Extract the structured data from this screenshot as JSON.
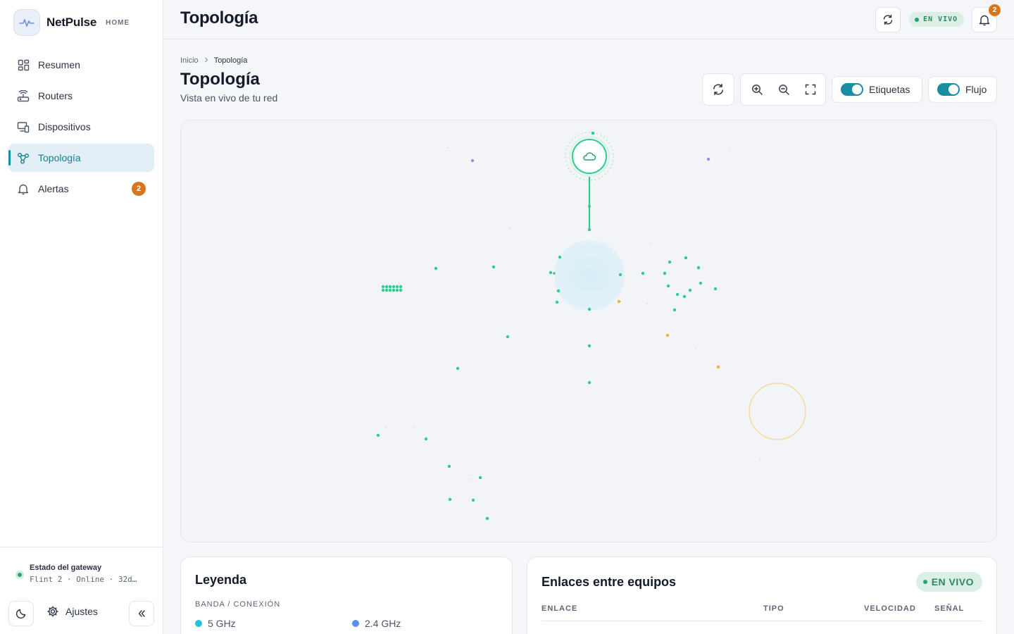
{
  "brand": {
    "name": "NetPulse",
    "tag": "HOME"
  },
  "nav": [
    {
      "label": "Resumen",
      "icon": "grid-icon"
    },
    {
      "label": "Routers",
      "icon": "router-icon"
    },
    {
      "label": "Dispositivos",
      "icon": "devices-icon"
    },
    {
      "label": "Topología",
      "icon": "topology-icon",
      "active": true
    },
    {
      "label": "Alertas",
      "icon": "bell-icon",
      "badge": "2"
    }
  ],
  "gateway": {
    "title": "Estado del gateway",
    "status": "Flint 2 · Online · 32d…"
  },
  "footer": {
    "settings_label": "Ajustes"
  },
  "topbar": {
    "title": "Topología",
    "live_label": "EN VIVO",
    "notifications": "2"
  },
  "breadcrumb": {
    "home": "Inicio",
    "current": "Topología"
  },
  "page": {
    "title": "Topología",
    "subtitle": "Vista en vivo de tu red"
  },
  "toolbar": {
    "labels_toggle": "Etiquetas",
    "labels_on": true,
    "flow_toggle": "Flujo",
    "flow_on": true
  },
  "legend": {
    "title": "Leyenda",
    "section": "BANDA / CONEXIÓN",
    "items": [
      {
        "label": "5 GHz",
        "color": "#22c3d8"
      },
      {
        "label": "2.4 GHz",
        "color": "#5b8fe6"
      }
    ]
  },
  "links": {
    "title": "Enlaces entre equipos",
    "live_label": "EN VIVO",
    "columns": [
      "ENLACE",
      "TIPO",
      "VELOCIDAD",
      "SEÑAL"
    ]
  },
  "colors": {
    "accent": "#1a8ea0",
    "online": "#2ecc8f",
    "warning": "#f0b429",
    "alert": "#d9761c",
    "purple": "#9b8ce0"
  }
}
